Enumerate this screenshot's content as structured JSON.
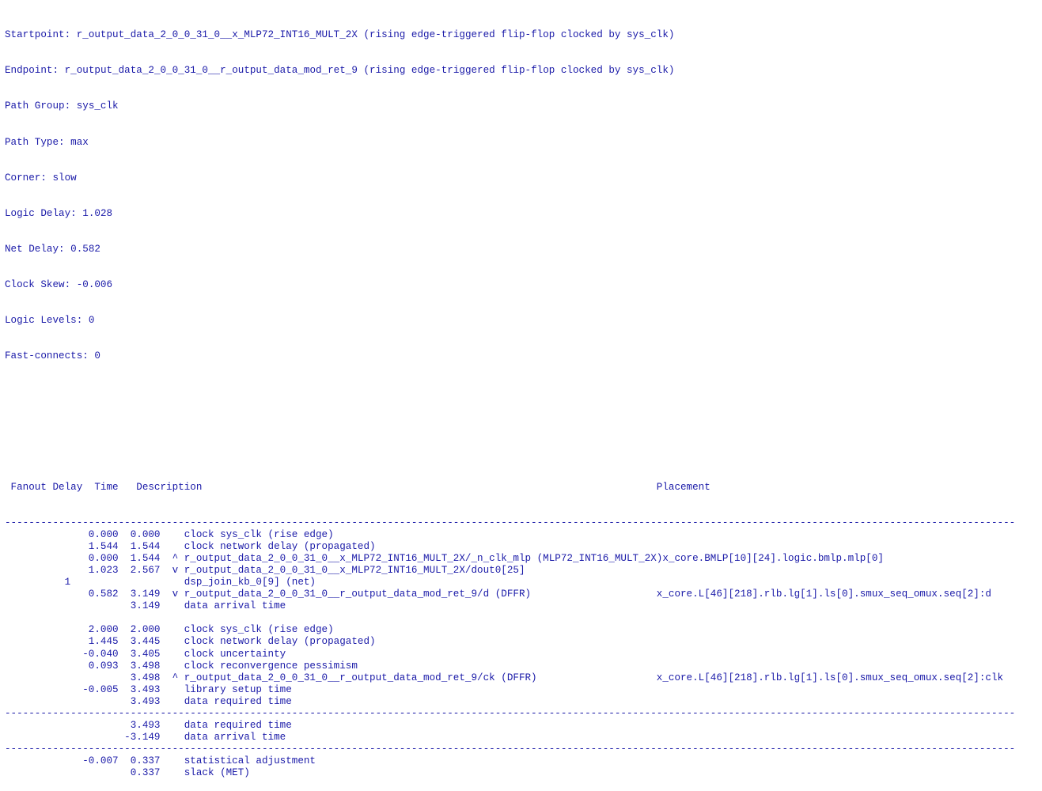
{
  "report": {
    "type": "static-timing-analysis-path-report",
    "text_color": "#1a1aa8",
    "background_color": "#ffffff",
    "header": {
      "startpoint_label": "Startpoint:",
      "startpoint_value": "r_output_data_2_0_0_31_0__x_MLP72_INT16_MULT_2X (rising edge-triggered flip-flop clocked by sys_clk)",
      "endpoint_label": "Endpoint:",
      "endpoint_value": "r_output_data_2_0_0_31_0__r_output_data_mod_ret_9 (rising edge-triggered flip-flop clocked by sys_clk)",
      "path_group_label": "Path Group:",
      "path_group_value": "sys_clk",
      "path_type_label": "Path Type:",
      "path_type_value": "max",
      "corner_label": "Corner:",
      "corner_value": "slow",
      "logic_delay_label": "Logic Delay:",
      "logic_delay_value": "1.028",
      "net_delay_label": "Net Delay:",
      "net_delay_value": "0.582",
      "clock_skew_label": "Clock Skew:",
      "clock_skew_value": "-0.006",
      "logic_levels_label": "Logic Levels:",
      "logic_levels_value": "0",
      "fast_connects_label": "Fast-connects:",
      "fast_connects_value": "0"
    },
    "columns": {
      "fanout": "Fanout",
      "delay": "Delay",
      "time": "Time",
      "description": "Description",
      "placement": "Placement"
    },
    "separator_char": "-",
    "separator_width_chars": 169,
    "lines": [
      {
        "kind": "sep"
      },
      {
        "kind": "row",
        "fanout": "",
        "delay": "0.000",
        "time": "0.000",
        "edge": "",
        "description": "clock sys_clk (rise edge)",
        "placement": ""
      },
      {
        "kind": "row",
        "fanout": "",
        "delay": "1.544",
        "time": "1.544",
        "edge": "",
        "description": "clock network delay (propagated)",
        "placement": ""
      },
      {
        "kind": "row",
        "fanout": "",
        "delay": "0.000",
        "time": "1.544",
        "edge": "^",
        "description": "r_output_data_2_0_0_31_0__x_MLP72_INT16_MULT_2X/_n_clk_mlp (MLP72_INT16_MULT_2X)",
        "placement": "x_core.BMLP[10][24].logic.bmlp.mlp[0]"
      },
      {
        "kind": "row",
        "fanout": "",
        "delay": "1.023",
        "time": "2.567",
        "edge": "v",
        "description": "r_output_data_2_0_0_31_0__x_MLP72_INT16_MULT_2X/dout0[25]",
        "placement": ""
      },
      {
        "kind": "row",
        "fanout": "1",
        "delay": "",
        "time": "",
        "edge": "",
        "description": "dsp_join_kb_0[9] (net)",
        "placement": ""
      },
      {
        "kind": "row",
        "fanout": "",
        "delay": "0.582",
        "time": "3.149",
        "edge": "v",
        "description": "r_output_data_2_0_0_31_0__r_output_data_mod_ret_9/d (DFFR)",
        "placement": "x_core.L[46][218].rlb.lg[1].ls[0].smux_seq_omux.seq[2]:d"
      },
      {
        "kind": "row",
        "fanout": "",
        "delay": "",
        "time": "3.149",
        "edge": "",
        "description": "data arrival time",
        "placement": ""
      },
      {
        "kind": "blank"
      },
      {
        "kind": "row",
        "fanout": "",
        "delay": "2.000",
        "time": "2.000",
        "edge": "",
        "description": "clock sys_clk (rise edge)",
        "placement": ""
      },
      {
        "kind": "row",
        "fanout": "",
        "delay": "1.445",
        "time": "3.445",
        "edge": "",
        "description": "clock network delay (propagated)",
        "placement": ""
      },
      {
        "kind": "row",
        "fanout": "",
        "delay": "-0.040",
        "time": "3.405",
        "edge": "",
        "description": "clock uncertainty",
        "placement": ""
      },
      {
        "kind": "row",
        "fanout": "",
        "delay": "0.093",
        "time": "3.498",
        "edge": "",
        "description": "clock reconvergence pessimism",
        "placement": ""
      },
      {
        "kind": "row",
        "fanout": "",
        "delay": "",
        "time": "3.498",
        "edge": "^",
        "description": "r_output_data_2_0_0_31_0__r_output_data_mod_ret_9/ck (DFFR)",
        "placement": "x_core.L[46][218].rlb.lg[1].ls[0].smux_seq_omux.seq[2]:clk"
      },
      {
        "kind": "row",
        "fanout": "",
        "delay": "-0.005",
        "time": "3.493",
        "edge": "",
        "description": "library setup time",
        "placement": ""
      },
      {
        "kind": "row",
        "fanout": "",
        "delay": "",
        "time": "3.493",
        "edge": "",
        "description": "data required time",
        "placement": ""
      },
      {
        "kind": "sep"
      },
      {
        "kind": "row",
        "fanout": "",
        "delay": "",
        "time": "3.493",
        "edge": "",
        "description": "data required time",
        "placement": ""
      },
      {
        "kind": "row",
        "fanout": "",
        "delay": "",
        "time": "-3.149",
        "edge": "",
        "description": "data arrival time",
        "placement": ""
      },
      {
        "kind": "sep"
      },
      {
        "kind": "row",
        "fanout": "",
        "delay": "-0.007",
        "time": "0.337",
        "edge": "",
        "description": "statistical adjustment",
        "placement": ""
      },
      {
        "kind": "row",
        "fanout": "",
        "delay": "",
        "time": "0.337",
        "edge": "",
        "description": "slack (MET)",
        "placement": ""
      }
    ]
  }
}
